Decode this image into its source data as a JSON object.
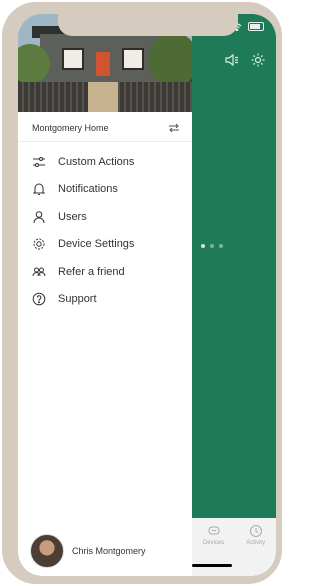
{
  "drawer": {
    "home_name": "Montgomery Home",
    "menu": [
      {
        "label": "Custom Actions",
        "icon": "sliders-icon"
      },
      {
        "label": "Notifications",
        "icon": "bell-icon"
      },
      {
        "label": "Users",
        "icon": "user-icon"
      },
      {
        "label": "Device Settings",
        "icon": "gear-icon"
      },
      {
        "label": "Refer a friend",
        "icon": "people-icon"
      },
      {
        "label": "Support",
        "icon": "question-circle-icon"
      }
    ],
    "profile_name": "Chris Montgomery"
  },
  "tabbar": {
    "items": [
      {
        "label": "Devices",
        "icon": "devices-icon"
      },
      {
        "label": "Activity",
        "icon": "clock-icon"
      }
    ]
  },
  "pager": {
    "count": 3,
    "active_index": 0
  },
  "colors": {
    "brand_green": "#1e7a57",
    "frame": "#d6cbbf"
  }
}
